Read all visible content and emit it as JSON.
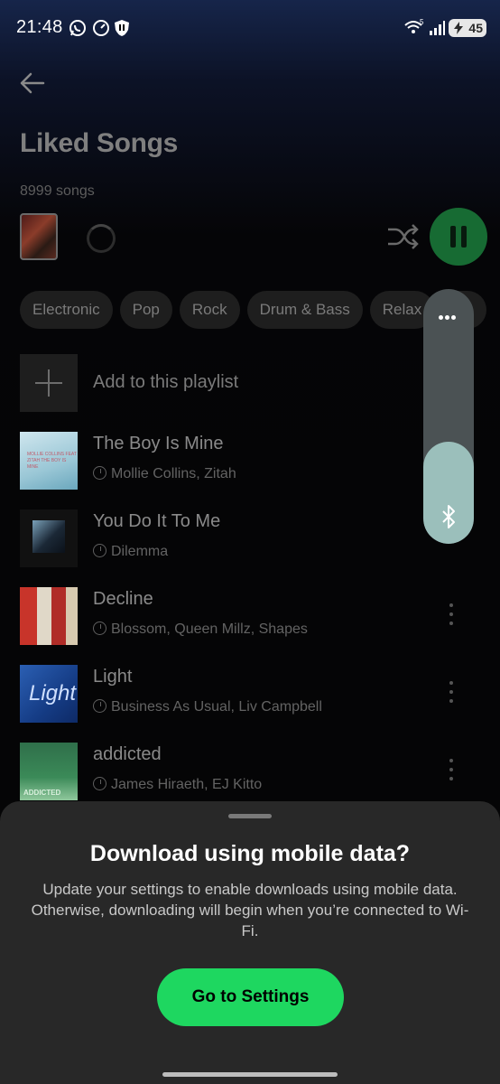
{
  "status_bar": {
    "time": "21:48",
    "battery": "45",
    "signal_label": "5"
  },
  "header": {
    "title": "Liked Songs",
    "song_count": "8999 songs"
  },
  "chips": [
    "Electronic",
    "Pop",
    "Rock",
    "Drum & Bass",
    "Relax",
    "Ne"
  ],
  "add_row": {
    "label": "Add to this playlist"
  },
  "songs": [
    {
      "title": "The Boy Is Mine",
      "artist": "Mollie Collins, Zitah",
      "art_text": "MOLLIE COLLINS FEAT ZITAH THE BOY IS MINE"
    },
    {
      "title": "You Do It To Me",
      "artist": "Dilemma"
    },
    {
      "title": "Decline",
      "artist": "Blossom, Queen Millz, Shapes"
    },
    {
      "title": "Light",
      "artist": "Business As Usual, Liv Campbell",
      "art_text": "Light"
    },
    {
      "title": "addicted",
      "artist": "James Hiraeth, EJ Kitto",
      "art_text": "ADDICTED"
    }
  ],
  "volume": {
    "level": 0.4
  },
  "sheet": {
    "title": "Download using mobile data?",
    "body": "Update your settings to enable downloads using mobile data. Otherwise, downloading will begin when you’re connected to Wi-Fi.",
    "button": "Go to Settings"
  },
  "colors": {
    "accent": "#1ed760",
    "sheet_bg": "#282828"
  }
}
